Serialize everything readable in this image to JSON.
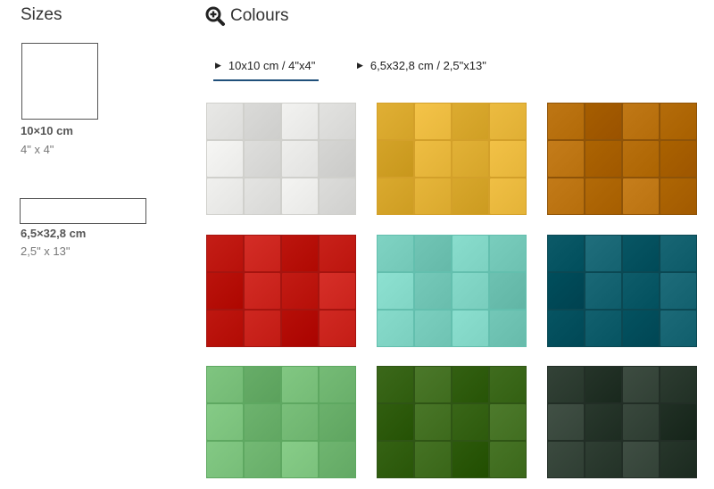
{
  "sizes": {
    "heading": "Sizes",
    "items": [
      {
        "metric": "10×10 cm",
        "imperial": "4\" x 4\""
      },
      {
        "metric": "6,5×32,8 cm",
        "imperial": "2,5\" x 13\""
      }
    ]
  },
  "colours": {
    "heading": "Colours",
    "zoom_icon": "zoom-in-icon",
    "tabs": [
      {
        "label": "10x10 cm / 4\"x4\"",
        "active": true
      },
      {
        "label": "6,5x32,8 cm / 2,5\"x13\"",
        "active": false
      }
    ],
    "swatches": [
      {
        "colour": "#e8e8e6",
        "grout": "#d0d0cc"
      },
      {
        "colour": "#e6b53a",
        "grout": "#d3a02a"
      },
      {
        "colour": "#b8700e",
        "grout": "#8e5308"
      },
      {
        "colour": "#c8211a",
        "grout": "#a5140f"
      },
      {
        "colour": "#7fd3c3",
        "grout": "#63bfae"
      },
      {
        "colour": "#12606e",
        "grout": "#0b4853"
      },
      {
        "colour": "#79bf7a",
        "grout": "#5ea861"
      },
      {
        "colour": "#3f6c1e",
        "grout": "#2f5515"
      },
      {
        "colour": "#334237",
        "grout": "#222e26"
      }
    ]
  }
}
